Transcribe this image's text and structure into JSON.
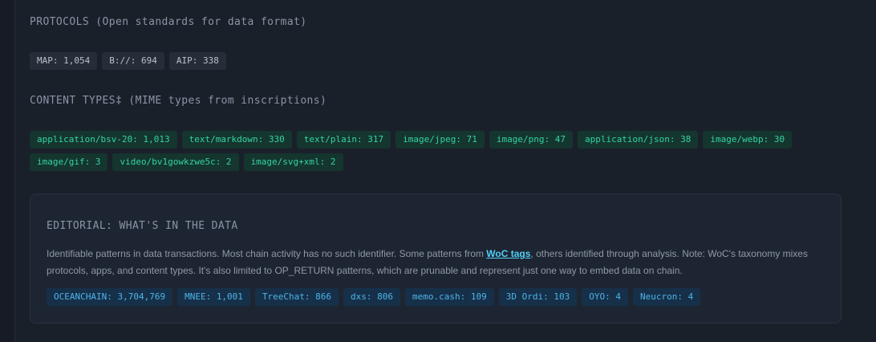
{
  "protocols": {
    "heading": "PROTOCOLS",
    "subheading": "(Open standards for data format)",
    "tags": [
      "MAP: 1,054",
      "B://: 694",
      "AIP: 338"
    ]
  },
  "content_types": {
    "heading": "CONTENT TYPES‡",
    "subheading": "(MIME types from inscriptions)",
    "tags": [
      "application/bsv-20: 1,013",
      "text/markdown: 330",
      "text/plain: 317",
      "image/jpeg: 71",
      "image/png: 47",
      "application/json: 38",
      "image/webp: 30",
      "image/gif: 3",
      "video/bv1gowkzwe5c: 2",
      "image/svg+xml: 2"
    ]
  },
  "editorial": {
    "heading": "EDITORIAL: WHAT'S IN THE DATA",
    "text_before_link": "Identifiable patterns in data transactions. Most chain activity has no such identifier. Some patterns from ",
    "link_text": "WoC tags",
    "text_after_link": ", others identified through analysis. Note: WoC's taxonomy mixes protocols, apps, and content types. It's also limited to OP_RETURN patterns, which are prunable and represent just one way to embed data on chain.",
    "tags": [
      "OCEANCHAIN: 3,704,769",
      "MNEE: 1,001",
      "TreeChat: 866",
      "dxs: 806",
      "memo.cash: 109",
      "3D Ordi: 103",
      "OYO: 4",
      "Neucron: 4"
    ]
  },
  "colors": {
    "background": "#161b24",
    "protocol_tag_bg": "#262d39",
    "content_tag_bg": "#15352f",
    "content_tag_text": "#33d4a3",
    "editorial_tag_bg": "#163049",
    "editorial_tag_text": "#4fb3e8",
    "link": "#4fd0f5"
  }
}
